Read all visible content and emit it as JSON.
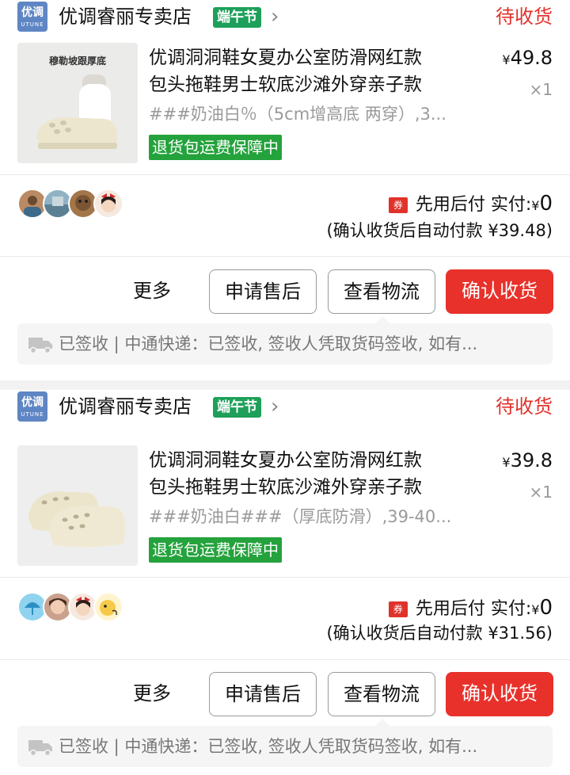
{
  "orders": [
    {
      "shop": {
        "logo_text_cn": "优调",
        "logo_text_en": "UTUNE",
        "name": "优调睿丽专卖店",
        "badge": "端午节",
        "status": "待收货"
      },
      "product": {
        "image_caption": "穆勒坡跟厚底",
        "title_line1": "优调洞洞鞋女夏办公室防滑网红款",
        "title_line2": "包头拖鞋男士软底沙滩外穿亲子款",
        "sku": "###奶油白％（5cm增高底 两穿）,3...",
        "return_badge": "退货包运费保障中",
        "currency": "¥",
        "price": "49.8",
        "qty": "×1"
      },
      "payment": {
        "coupon": "券",
        "label": "先用后付 实付:",
        "currency": "¥",
        "amount": "0",
        "auto_pay": "(确认收货后自动付款 ¥39.48)"
      },
      "actions": {
        "more": "更多",
        "after_sale": "申请售后",
        "logistics": "查看物流",
        "confirm": "确认收货"
      },
      "logistics": "已签收 | 中通快递：已签收, 签收人凭取货码签收, 如有..."
    },
    {
      "shop": {
        "logo_text_cn": "优调",
        "logo_text_en": "UTUNE",
        "name": "优调睿丽专卖店",
        "badge": "端午节",
        "status": "待收货"
      },
      "product": {
        "image_caption": "",
        "title_line1": "优调洞洞鞋女夏办公室防滑网红款",
        "title_line2": "包头拖鞋男士软底沙滩外穿亲子款",
        "sku": "###奶油白###（厚底防滑）,39-40...",
        "return_badge": "退货包运费保障中",
        "currency": "¥",
        "price": "39.8",
        "qty": "×1"
      },
      "payment": {
        "coupon": "券",
        "label": "先用后付 实付:",
        "currency": "¥",
        "amount": "0",
        "auto_pay": "(确认收货后自动付款 ¥31.56)"
      },
      "actions": {
        "more": "更多",
        "after_sale": "申请售后",
        "logistics": "查看物流",
        "confirm": "确认收货"
      },
      "logistics": "已签收 | 中通快递：已签收, 签收人凭取货码签收, 如有..."
    }
  ],
  "colors": {
    "accent_red": "#e8312b",
    "status_red": "#e0322b",
    "badge_green": "#1ea05a",
    "return_green": "#24a23c",
    "logo_blue": "#5f86c4"
  },
  "icons": [
    "chevron-right-icon",
    "coupon-icon",
    "truck-icon",
    "avatar"
  ]
}
